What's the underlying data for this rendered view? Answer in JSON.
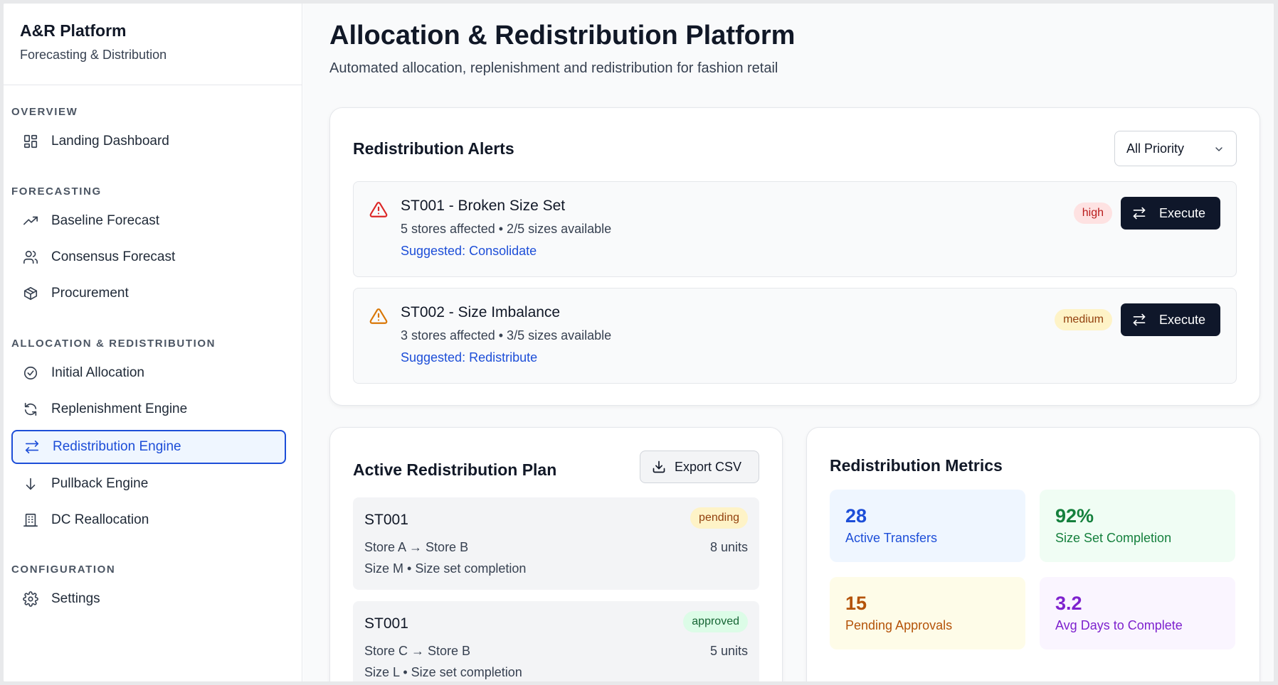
{
  "brand": {
    "title": "A&R Platform",
    "subtitle": "Forecasting & Distribution"
  },
  "nav": {
    "sections": [
      {
        "label": "OVERVIEW",
        "items": [
          {
            "label": "Landing Dashboard",
            "icon": "grid-icon"
          }
        ]
      },
      {
        "label": "FORECASTING",
        "items": [
          {
            "label": "Baseline Forecast",
            "icon": "trending-up-icon"
          },
          {
            "label": "Consensus Forecast",
            "icon": "users-icon"
          },
          {
            "label": "Procurement",
            "icon": "package-icon"
          }
        ]
      },
      {
        "label": "ALLOCATION & REDISTRIBUTION",
        "items": [
          {
            "label": "Initial Allocation",
            "icon": "check-circle-icon"
          },
          {
            "label": "Replenishment Engine",
            "icon": "refresh-icon"
          },
          {
            "label": "Redistribution Engine",
            "icon": "arrows-swap-icon",
            "active": true
          },
          {
            "label": "Pullback Engine",
            "icon": "arrow-down-icon"
          },
          {
            "label": "DC Reallocation",
            "icon": "building-icon"
          }
        ]
      },
      {
        "label": "CONFIGURATION",
        "items": [
          {
            "label": "Settings",
            "icon": "gear-icon"
          }
        ]
      }
    ]
  },
  "page": {
    "title": "Allocation & Redistribution Platform",
    "subtitle": "Automated allocation, replenishment and redistribution for fashion retail"
  },
  "alerts_card": {
    "title": "Redistribution Alerts",
    "filter": "All Priority",
    "alerts": [
      {
        "title": "ST001 - Broken Size Set",
        "meta": "5 stores affected • 2/5 sizes available",
        "suggestion": "Suggested: Consolidate",
        "priority": "high",
        "action": "Execute",
        "color": "#dc2626"
      },
      {
        "title": "ST002 - Size Imbalance",
        "meta": "3 stores affected • 3/5 sizes available",
        "suggestion": "Suggested: Redistribute",
        "priority": "medium",
        "action": "Execute",
        "color": "#d97706"
      }
    ]
  },
  "plan_card": {
    "title": "Active Redistribution Plan",
    "export_label": "Export CSV",
    "items": [
      {
        "id": "ST001",
        "status": "pending",
        "route": "Store A → Store B",
        "units": "8 units",
        "detail": "Size M • Size set completion"
      },
      {
        "id": "ST001",
        "status": "approved",
        "route": "Store C → Store B",
        "units": "5 units",
        "detail": "Size L • Size set completion"
      }
    ]
  },
  "metrics_card": {
    "title": "Redistribution Metrics",
    "metrics": [
      {
        "value": "28",
        "label": "Active Transfers",
        "bg": "#eff6ff",
        "color": "#1d4ed8"
      },
      {
        "value": "92%",
        "label": "Size Set Completion",
        "bg": "#f0fdf4",
        "color": "#15803d"
      },
      {
        "value": "15",
        "label": "Pending Approvals",
        "bg": "#fefce8",
        "color": "#b45309"
      },
      {
        "value": "3.2",
        "label": "Avg Days to Complete",
        "bg": "#faf5ff",
        "color": "#7e22ce"
      }
    ]
  }
}
